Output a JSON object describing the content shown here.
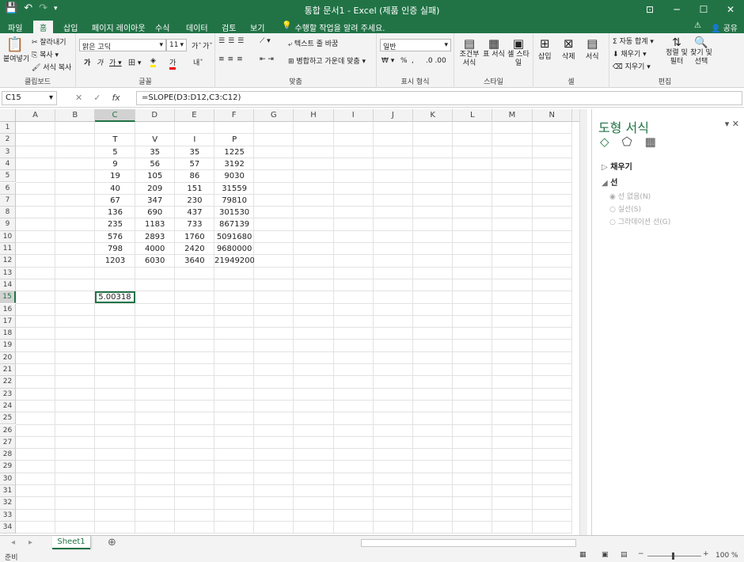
{
  "window": {
    "title": "통합 문서1 - Excel (제품 인증 실패)",
    "controls": [
      "restore-ribbon",
      "minimize",
      "maximize",
      "close"
    ]
  },
  "tabs": [
    "파일",
    "홈",
    "삽입",
    "페이지 레이아웃",
    "수식",
    "데이터",
    "검토",
    "보기"
  ],
  "active_tab": "홈",
  "tell_me": "수행할 작업을 알려 주세요.",
  "share": "공유",
  "ribbon": {
    "clipboard": {
      "label": "클립보드",
      "paste": "붙여넣기",
      "cut": "잘라내기",
      "copy": "복사",
      "format_painter": "서식 복사"
    },
    "font": {
      "label": "글꼴",
      "name": "맑은 고딕",
      "size": "11",
      "grow": "가",
      "shrink": "가",
      "bold": "가",
      "italic": "가",
      "underline": "가",
      "border": "田",
      "fill": "가",
      "color": "가",
      "phonetic": "내천"
    },
    "alignment": {
      "label": "맞춤",
      "wrap": "텍스트 줄 바꿈",
      "merge": "병합하고 가운데 맞춤"
    },
    "number": {
      "label": "표시 형식",
      "format": "일반",
      "percent": "%",
      "comma": ","
    },
    "styles": {
      "label": "스타일",
      "conditional": "조건부 서식",
      "table": "표 서식",
      "cell": "셀 스타일"
    },
    "cells": {
      "label": "셀",
      "insert": "삽입",
      "delete": "삭제",
      "format": "서식"
    },
    "editing": {
      "label": "편집",
      "autosum": "자동 합계",
      "fill": "채우기",
      "clear": "지우기",
      "sort": "정렬 및 필터",
      "find": "찾기 및 선택"
    }
  },
  "formula_bar": {
    "name_box": "C15",
    "formula": "=SLOPE(D3:D12,C3:C12)"
  },
  "columns": [
    "A",
    "B",
    "C",
    "D",
    "E",
    "F",
    "G",
    "H",
    "I",
    "J",
    "K",
    "L",
    "M",
    "N"
  ],
  "selected_column": "C",
  "rows": [
    "1",
    "2",
    "3",
    "4",
    "5",
    "6",
    "7",
    "8",
    "9",
    "10",
    "11",
    "12",
    "13",
    "14",
    "15",
    "16",
    "17",
    "18",
    "19",
    "20",
    "21",
    "22",
    "23",
    "24",
    "25",
    "26",
    "27",
    "28",
    "29",
    "30",
    "31",
    "32",
    "33",
    "34"
  ],
  "selected_row": "15",
  "table": {
    "headers": [
      "T",
      "V",
      "I",
      "P"
    ],
    "rows": [
      [
        "5",
        "35",
        "35",
        "1225"
      ],
      [
        "9",
        "56",
        "57",
        "3192"
      ],
      [
        "19",
        "105",
        "86",
        "9030"
      ],
      [
        "40",
        "209",
        "151",
        "31559"
      ],
      [
        "67",
        "347",
        "230",
        "79810"
      ],
      [
        "136",
        "690",
        "437",
        "301530"
      ],
      [
        "235",
        "1183",
        "733",
        "867139"
      ],
      [
        "576",
        "2893",
        "1760",
        "5091680"
      ],
      [
        "798",
        "4000",
        "2420",
        "9680000"
      ],
      [
        "1203",
        "6030",
        "3640",
        "21949200"
      ]
    ]
  },
  "result_cell": {
    "ref": "C15",
    "value": "5.00318"
  },
  "sheet_tabs": [
    "Sheet1"
  ],
  "active_sheet": "Sheet1",
  "status": {
    "ready": "준비",
    "zoom": "100 %"
  },
  "format_pane": {
    "title": "도형 서식",
    "sections": [
      "채우기",
      "선"
    ],
    "line_options": [
      "선 없음(N)",
      "실선(S)",
      "그라데이션 선(G)"
    ]
  },
  "colors": {
    "accent": "#217346",
    "selected_fill": "#d2d2d2"
  }
}
